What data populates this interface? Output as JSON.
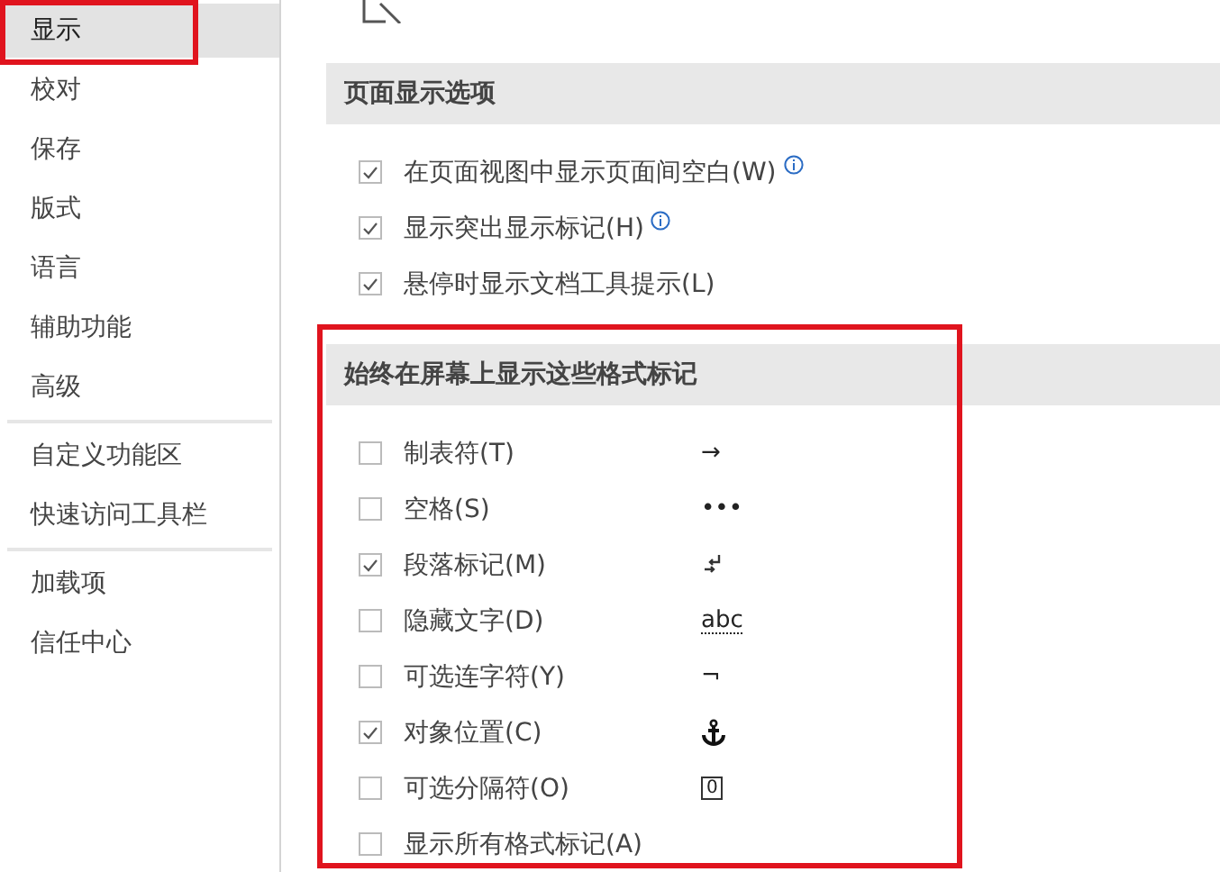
{
  "sidebar": {
    "groups": [
      {
        "items": [
          {
            "label": "显示",
            "selected": true
          },
          {
            "label": "校对",
            "selected": false
          },
          {
            "label": "保存",
            "selected": false
          },
          {
            "label": "版式",
            "selected": false
          },
          {
            "label": "语言",
            "selected": false
          },
          {
            "label": "辅助功能",
            "selected": false
          },
          {
            "label": "高级",
            "selected": false
          }
        ]
      },
      {
        "items": [
          {
            "label": "自定义功能区",
            "selected": false
          },
          {
            "label": "快速访问工具栏",
            "selected": false
          }
        ]
      },
      {
        "items": [
          {
            "label": "加载项",
            "selected": false
          },
          {
            "label": "信任中心",
            "selected": false
          }
        ]
      }
    ]
  },
  "sections": [
    {
      "title": "页面显示选项",
      "options": [
        {
          "label": "在页面视图中显示页面间空白(W)",
          "checked": true,
          "info": true
        },
        {
          "label": "显示突出显示标记(H)",
          "checked": true,
          "info": true
        },
        {
          "label": "悬停时显示文档工具提示(L)",
          "checked": true,
          "info": false
        }
      ]
    },
    {
      "title": "始终在屏幕上显示这些格式标记",
      "options": [
        {
          "label": "制表符(T)",
          "checked": false,
          "symbol": {
            "kind": "text",
            "text": "→"
          }
        },
        {
          "label": "空格(S)",
          "checked": false,
          "symbol": {
            "kind": "text",
            "text": "•••"
          }
        },
        {
          "label": "段落标记(M)",
          "checked": true,
          "symbol": {
            "kind": "paragraph"
          }
        },
        {
          "label": "隐藏文字(D)",
          "checked": false,
          "symbol": {
            "kind": "dotted",
            "text": "abc"
          }
        },
        {
          "label": "可选连字符(Y)",
          "checked": false,
          "symbol": {
            "kind": "text",
            "text": "¬"
          }
        },
        {
          "label": "对象位置(C)",
          "checked": true,
          "symbol": {
            "kind": "anchor"
          }
        },
        {
          "label": "可选分隔符(O)",
          "checked": false,
          "symbol": {
            "kind": "boxed",
            "text": "0"
          }
        },
        {
          "label": "显示所有格式标记(A)",
          "checked": false
        }
      ]
    }
  ]
}
